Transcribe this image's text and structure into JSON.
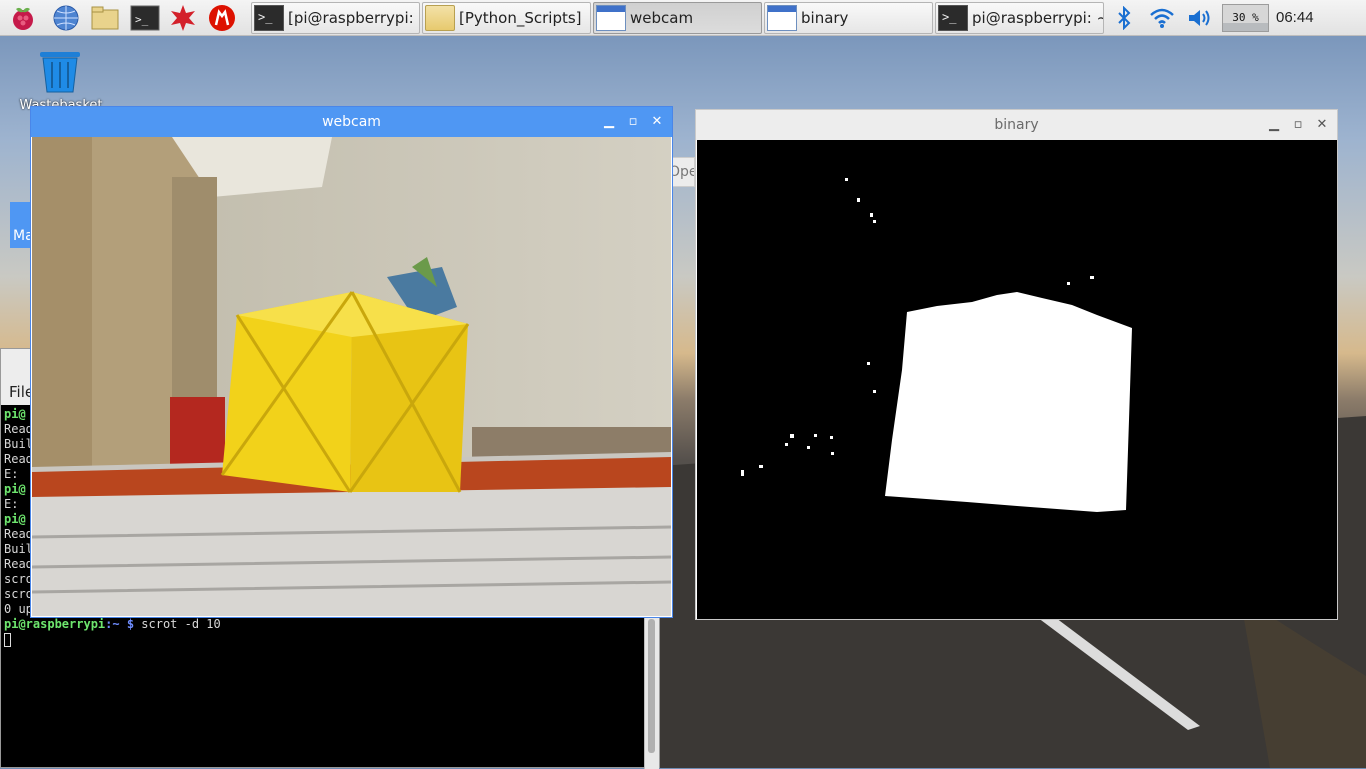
{
  "taskbar": {
    "launchers": [
      {
        "name": "raspberry-menu-icon"
      },
      {
        "name": "web-browser-icon"
      },
      {
        "name": "file-manager-icon"
      },
      {
        "name": "terminal-icon"
      },
      {
        "name": "math-kernel-icon"
      },
      {
        "name": "wolfram-icon"
      }
    ],
    "tasks": [
      {
        "label": "[pi@raspberrypi: ...",
        "icon": "terminal",
        "active": false
      },
      {
        "label": "[Python_Scripts]",
        "icon": "folder",
        "active": false
      },
      {
        "label": "webcam",
        "icon": "window",
        "active": true
      },
      {
        "label": "binary",
        "icon": "window",
        "active": false
      },
      {
        "label": "pi@raspberrypi: ~",
        "icon": "terminal",
        "active": false
      }
    ],
    "cpu_label": "30 %",
    "cpu_fraction": 0.3,
    "clock": "06:44"
  },
  "desktop": {
    "trash_label": "Wastebasket",
    "partial_texts": {
      "ope": "Ope",
      "ma": "Ma"
    }
  },
  "terminal": {
    "menu_label": "File",
    "lines": [
      {
        "text": "pi@",
        "type": "user"
      },
      {
        "text": "Read",
        "type": "plain"
      },
      {
        "text": "Buil",
        "type": "plain"
      },
      {
        "text": "Read",
        "type": "plain"
      },
      {
        "text": "E: ",
        "type": "plain"
      },
      {
        "text": "pi@",
        "type": "user"
      },
      {
        "text": "E: ",
        "type": "plain"
      },
      {
        "text": "pi@",
        "type": "user"
      },
      {
        "text": "Read",
        "type": "plain"
      },
      {
        "text": "Buil",
        "type": "plain"
      },
      {
        "text": "Read",
        "type": "plain"
      },
      {
        "text": "scro",
        "type": "plain"
      },
      {
        "text": "scro",
        "type": "plain"
      },
      {
        "text": "0 up",
        "type": "plain"
      }
    ],
    "prompt": {
      "user": "pi@raspberrypi",
      "path": ":~",
      "symbol": " $",
      "command": " scrot -d 10"
    }
  },
  "webcam": {
    "title": "webcam"
  },
  "binary": {
    "title": "binary"
  },
  "colors": {
    "active_title": "#4f97f3",
    "prompt_user": "#6ee66e",
    "prompt_path": "#6f8dff"
  }
}
